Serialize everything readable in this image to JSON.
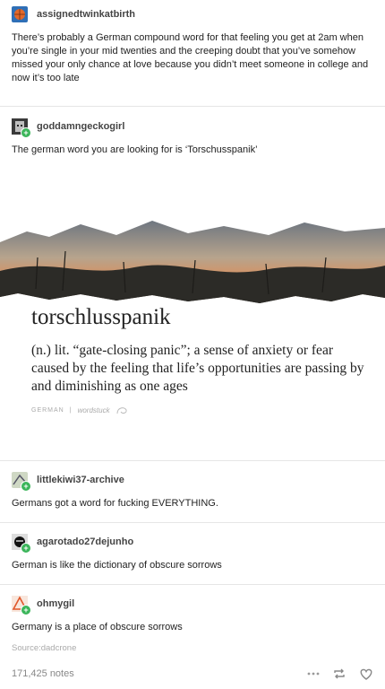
{
  "posts": [
    {
      "username": "assignedtwinkatbirth",
      "text": "There’s probably a German compound word for that feeling you get at 2am when you’re single in your mid twenties and the creeping doubt that you’ve somehow missed your only chance at love because you didn’t meet someone in college and now it’s too late"
    },
    {
      "username": "goddamngeckogirl",
      "text": "The german word you are looking for is ‘Torschusspanik’"
    },
    {
      "username": "littlekiwi37-archive",
      "text": "Germans got a word for fucking EVERYTHING."
    },
    {
      "username": "agarotado27dejunho",
      "text": "German is like the dictionary of obscure sorrows"
    },
    {
      "username": "ohmygil",
      "text": "Germany is a place of obscure sorrows"
    }
  ],
  "image_card": {
    "word": "torschlusspanik",
    "definition": "(n.) lit. “gate-closing panic”; a sense of anxiety or fear caused by the feeling that life’s opportunities are passing by and diminishing as one ages",
    "language": "GERMAN",
    "divider": "|",
    "brand": "wordstuck"
  },
  "source": "Source:dadcrone",
  "notes": "171,425 notes",
  "icons": [
    "more-icon",
    "reblog-icon",
    "heart-icon"
  ],
  "colors": {
    "follow_badge": "#3bb55a",
    "accent_border": "#e6e6e6"
  }
}
